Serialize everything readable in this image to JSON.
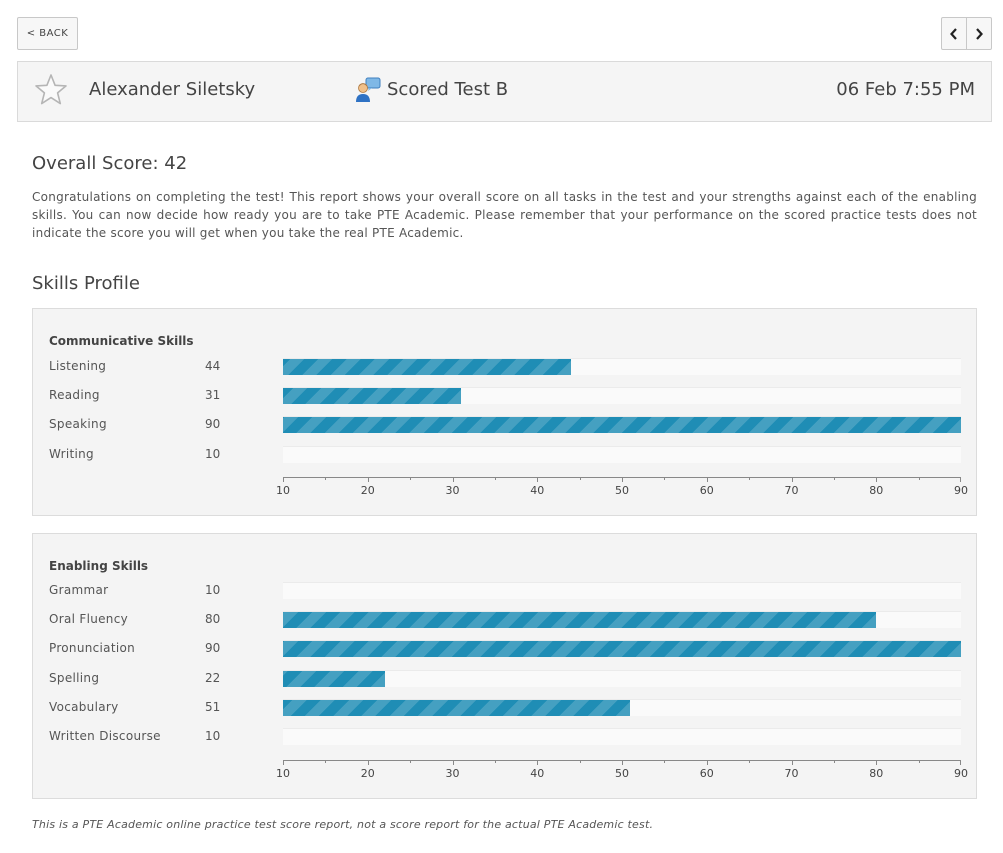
{
  "nav": {
    "back_label": "< BACK"
  },
  "header": {
    "user_name": "Alexander Siletsky",
    "test_name": "Scored Test B",
    "date": "06 Feb 7:55 PM"
  },
  "overall": {
    "title": "Overall Score: 42",
    "score": 42,
    "description": "Congratulations on completing the test! This report shows your overall score on all tasks in the test and your strengths against each of the enabling skills. You can now decide how ready you are to take PTE Academic. Please remember that your performance on the scored practice tests does not indicate the score you will get when you take the real PTE Academic."
  },
  "skills_profile_title": "Skills Profile",
  "communicative": {
    "title": "Communicative Skills",
    "skills": [
      {
        "label": "Listening",
        "score": 44
      },
      {
        "label": "Reading",
        "score": 31
      },
      {
        "label": "Speaking",
        "score": 90
      },
      {
        "label": "Writing",
        "score": 10
      }
    ]
  },
  "enabling": {
    "title": "Enabling Skills",
    "skills": [
      {
        "label": "Grammar",
        "score": 10
      },
      {
        "label": "Oral Fluency",
        "score": 80
      },
      {
        "label": "Pronunciation",
        "score": 90
      },
      {
        "label": "Spelling",
        "score": 22
      },
      {
        "label": "Vocabulary",
        "score": 51
      },
      {
        "label": "Written Discourse",
        "score": 10
      }
    ]
  },
  "chart_data": [
    {
      "type": "bar",
      "title": "Communicative Skills",
      "categories": [
        "Listening",
        "Reading",
        "Speaking",
        "Writing"
      ],
      "values": [
        44,
        31,
        90,
        10
      ],
      "xlim": [
        10,
        90
      ],
      "ticks": [
        10,
        20,
        30,
        40,
        50,
        60,
        70,
        80,
        90
      ],
      "orientation": "horizontal",
      "bar_color": "#1f8db5"
    },
    {
      "type": "bar",
      "title": "Enabling Skills",
      "categories": [
        "Grammar",
        "Oral Fluency",
        "Pronunciation",
        "Spelling",
        "Vocabulary",
        "Written Discourse"
      ],
      "values": [
        10,
        80,
        90,
        22,
        51,
        10
      ],
      "xlim": [
        10,
        90
      ],
      "ticks": [
        10,
        20,
        30,
        40,
        50,
        60,
        70,
        80,
        90
      ],
      "orientation": "horizontal",
      "bar_color": "#1f8db5"
    }
  ],
  "footnote": "This is a PTE Academic online practice test score report, not a score report for the actual PTE Academic test."
}
